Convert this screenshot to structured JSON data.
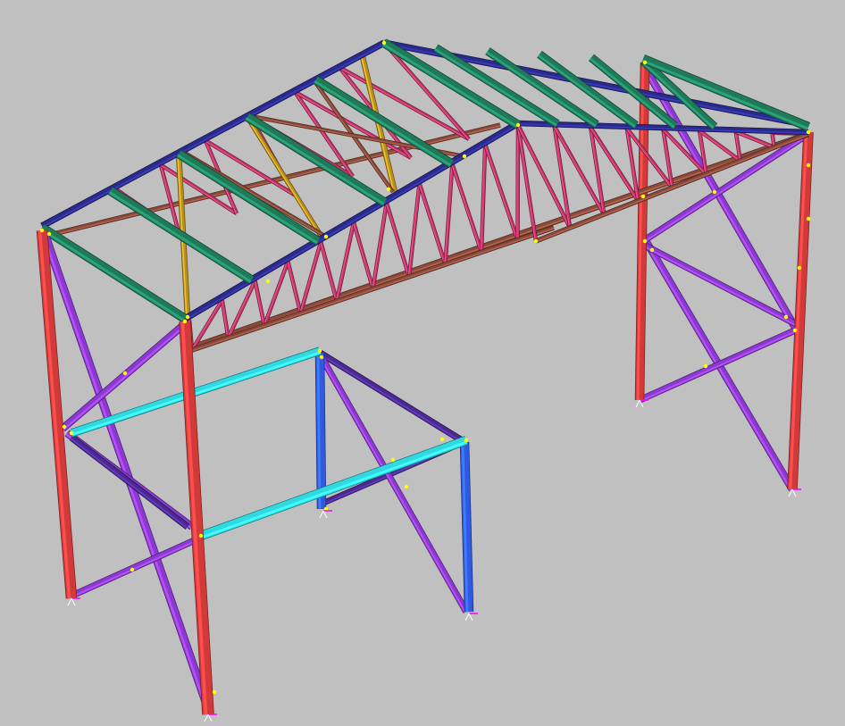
{
  "viewport": {
    "background": "#c0c0c0"
  },
  "palette": {
    "column_red": "#d23a3a",
    "column_blue": "#2f5ae0",
    "roof_chord": "#2a2a8a",
    "purlin": "#1f7a5a",
    "truss_web": "#c0386a",
    "bottom_chord": "#8a4a3a",
    "rafter_bracing": "#b89020",
    "wall_bracing": "#8a3ad0",
    "mezzanine_beam": "#30d8e0",
    "mezzanine_frame": "#4a2a90",
    "node_marker": "#ffff00",
    "support_marker": "#ff00ff"
  },
  "legend": []
}
